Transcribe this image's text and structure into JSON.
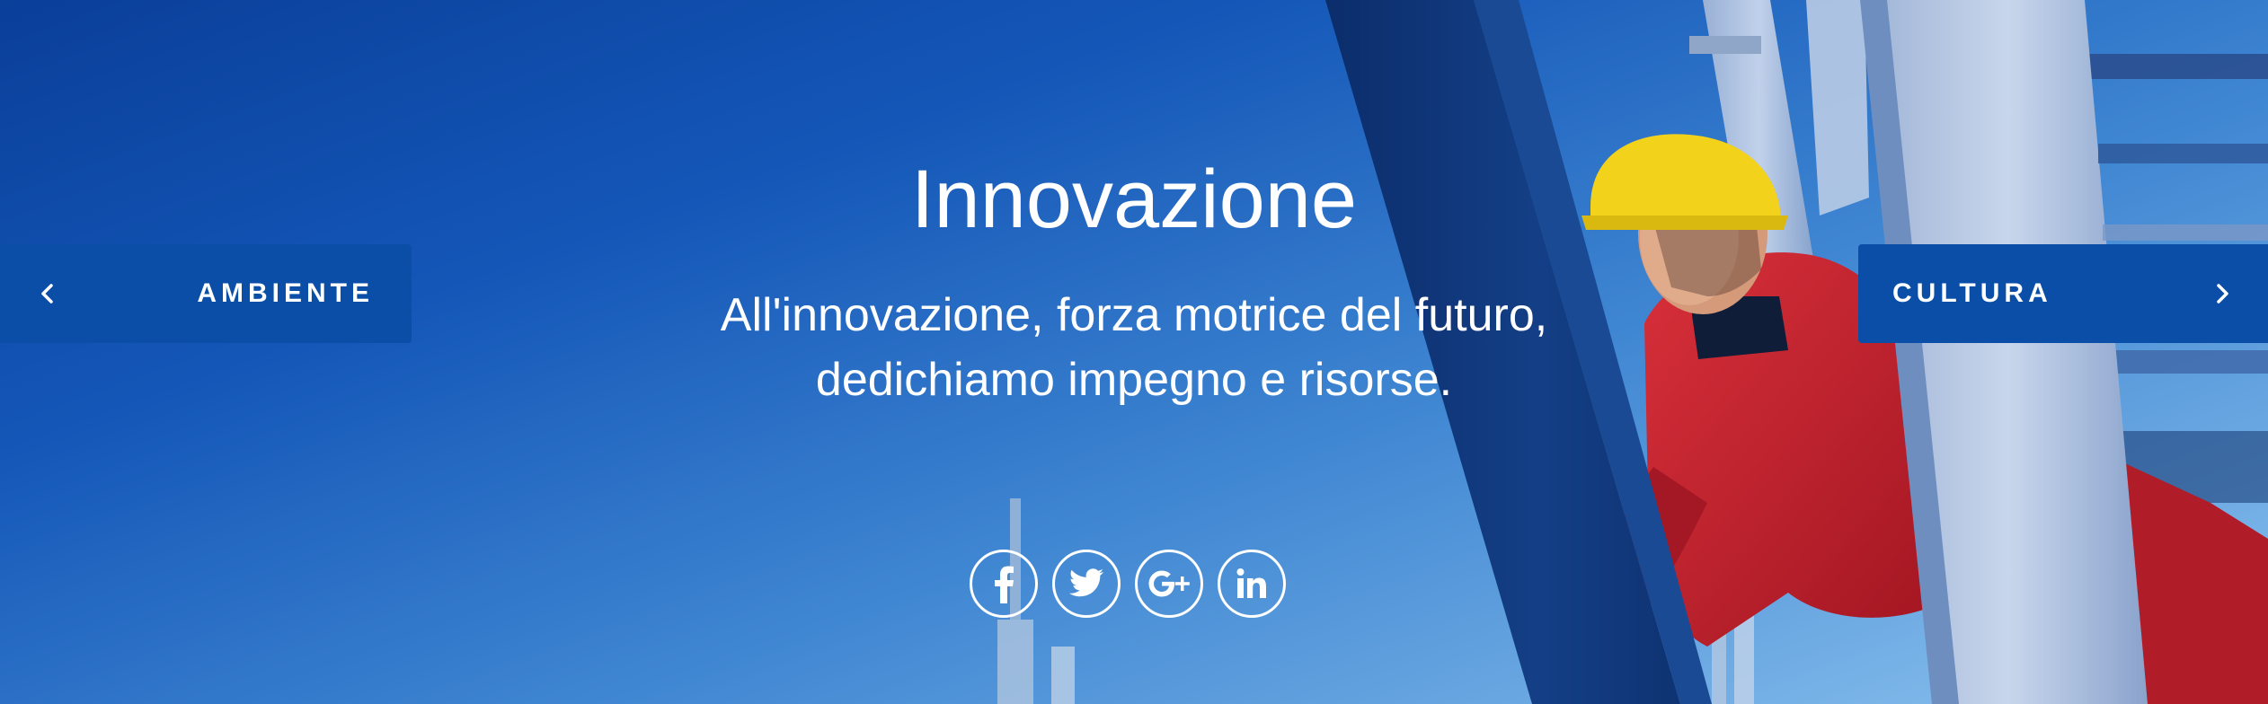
{
  "hero": {
    "title": "Innovazione",
    "subtitle_line1": "All'innovazione, forza motrice del futuro,",
    "subtitle_line2": "dedichiamo impegno e risorse."
  },
  "nav": {
    "prev_label": "AMBIENTE",
    "next_label": "CULTURA"
  },
  "social": {
    "facebook": "facebook-icon",
    "twitter": "twitter-icon",
    "googleplus": "google-plus-icon",
    "linkedin": "linkedin-icon"
  },
  "colors": {
    "nav_button_bg": "#0a4ea8",
    "text": "#ffffff",
    "sky_dark": "#0a3f9a",
    "sky_light": "#8cc2ee",
    "jacket_red": "#c41e2a",
    "helmet_yellow": "#f2d21a"
  }
}
